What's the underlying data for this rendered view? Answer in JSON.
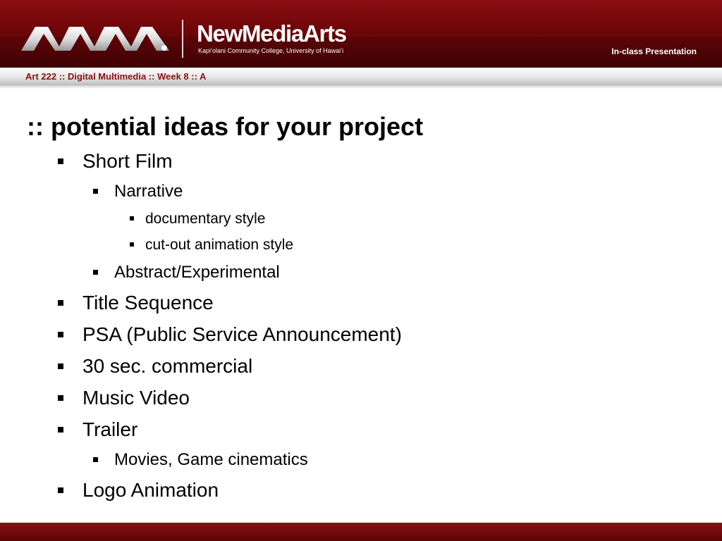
{
  "header": {
    "brand_name": "NewMediaArts",
    "brand_subtitle": "Kapi‘olani Community College, University of Hawai‘i",
    "right_label": "In-class Presentation",
    "logo_icon": "nma-logo-icon"
  },
  "subbar": {
    "course": "Art 222 :: Digital Multimedia :: Week 8 :: A"
  },
  "slide": {
    "title": ":: potential ideas for your project",
    "items": [
      {
        "label": "Short Film",
        "level": 1
      },
      {
        "label": "Narrative",
        "level": 2
      },
      {
        "label": "documentary style",
        "level": 3
      },
      {
        "label": "cut-out animation style",
        "level": 3
      },
      {
        "label": "Abstract/Experimental",
        "level": 2
      },
      {
        "label": "Title Sequence",
        "level": 1
      },
      {
        "label": "PSA (Public Service Announcement)",
        "level": 1
      },
      {
        "label": "30 sec. commercial",
        "level": 1
      },
      {
        "label": "Music Video",
        "level": 1
      },
      {
        "label": "Trailer",
        "level": 1
      },
      {
        "label": "Movies, Game cinematics",
        "level": 2
      },
      {
        "label": "Logo Animation",
        "level": 1
      }
    ]
  },
  "colors": {
    "brand_red": "#6e0508",
    "course_label": "#8b1012",
    "footer_red": "#7a0a0d"
  }
}
